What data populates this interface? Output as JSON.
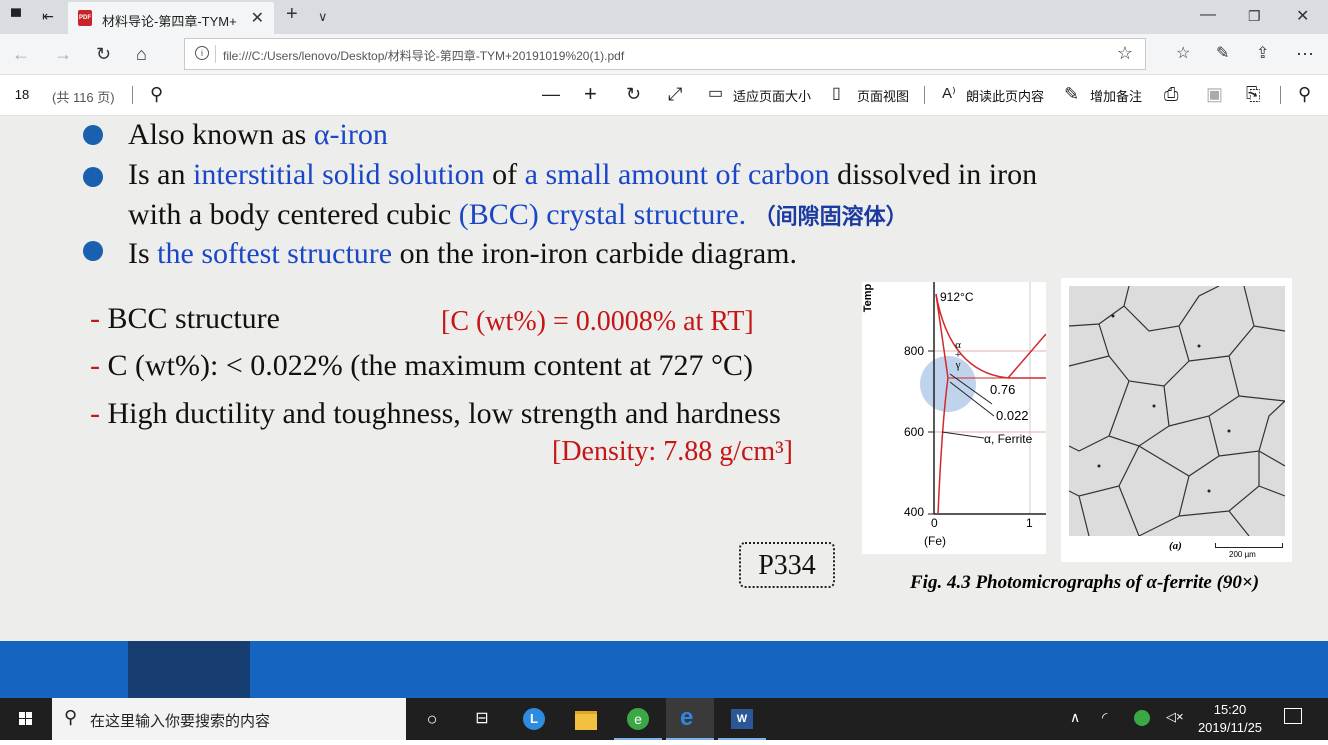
{
  "browser": {
    "tab_title": "材料导论-第四章-TYM+",
    "url": "file:///C:/Users/lenovo/Desktop/材料导论-第四章-TYM+20191019%20(1).pdf"
  },
  "pdf_toolbar": {
    "page_number": "18",
    "page_total": "(共 116 页)",
    "fit_page": "适应页面大小",
    "page_view": "页面视图",
    "read_aloud": "朗读此页内容",
    "add_notes": "增加备注"
  },
  "slide": {
    "bullets": [
      {
        "a": "Also known as ",
        "b": "α-iron"
      },
      {
        "a": "Is an ",
        "b": "interstitial solid solution",
        "c": " of ",
        "d": "a small amount of carbon",
        "e": " dissolved in iron"
      },
      {
        "a": "with a body centered cubic ",
        "b": "(BCC) crystal structure.",
        "c": "（间隙固溶体）"
      },
      {
        "a": "Is ",
        "b": "the softest structure",
        "c": " on the iron-iron carbide diagram."
      }
    ],
    "dash": "- ",
    "props": [
      "BCC structure",
      "C (wt%): < 0.022% (the maximum content at 727 °C)",
      "High ductility and toughness, low strength and hardness"
    ],
    "carbon_note": "[C (wt%) = 0.0008% at RT]",
    "density_note": "[Density: 7.88 g/cm³]",
    "page_ref": "P334",
    "figure_caption": "Fig. 4.3 Photomicrographs of α-ferrite (90×)",
    "phase_diagram": {
      "ylabel": "Temp",
      "top_label": "912°C",
      "y800": "800",
      "y600": "600",
      "y400": "400",
      "x0": "0",
      "x1": "1",
      "fe": "(Fe)",
      "alpha_gamma_1": "α",
      "alpha_gamma_2": "+",
      "alpha_gamma_3": "γ",
      "c076": "0.76",
      "c0022": "0.022",
      "ferrite": "α, Ferrite"
    },
    "micro": {
      "label_a": "(a)",
      "scale": "200 µm"
    }
  },
  "taskbar": {
    "search_placeholder": "在这里输入你要搜索的内容",
    "time": "15:20",
    "date": "2019/11/25"
  }
}
